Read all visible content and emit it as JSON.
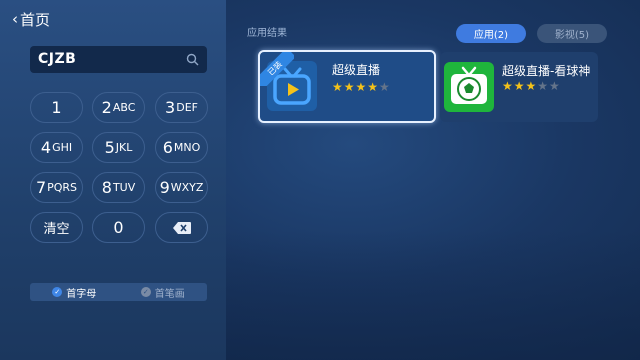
{
  "nav": {
    "back_label": "首页"
  },
  "search": {
    "value": "CJZB"
  },
  "keypad": [
    {
      "num": "1",
      "letters": ""
    },
    {
      "num": "2",
      "letters": "ABC"
    },
    {
      "num": "3",
      "letters": "DEF"
    },
    {
      "num": "4",
      "letters": "GHI"
    },
    {
      "num": "5",
      "letters": "JKL"
    },
    {
      "num": "6",
      "letters": "MNO"
    },
    {
      "num": "7",
      "letters": "PQRS"
    },
    {
      "num": "8",
      "letters": "TUV"
    },
    {
      "num": "9",
      "letters": "WXYZ"
    },
    {
      "clear": "清空"
    },
    {
      "num": "0",
      "letters": ""
    }
  ],
  "input_mode": {
    "option1": "首字母",
    "option2": "首笔画",
    "selected": "首字母"
  },
  "results": {
    "section_title": "应用结果",
    "tabs": [
      {
        "label": "应用(2)",
        "active": true
      },
      {
        "label": "影视(5)",
        "active": false
      }
    ],
    "apps": [
      {
        "name": "超级直播",
        "rating": 4,
        "max_rating": 5,
        "badge": "已装",
        "selected": true,
        "icon_color": "#2f90e6"
      },
      {
        "name": "超级直播-看球神",
        "rating": 3,
        "max_rating": 5,
        "badge": "",
        "selected": false,
        "icon_color": "#1fb53c"
      }
    ]
  },
  "colors": {
    "accent": "#3f7be0",
    "star": "#f4c21a",
    "panel": "#2a4f82"
  }
}
